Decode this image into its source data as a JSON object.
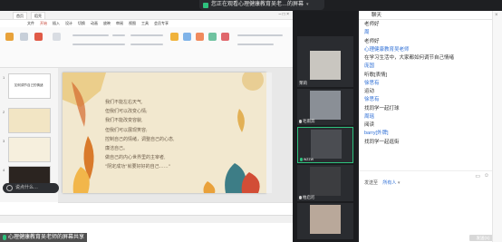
{
  "banner": {
    "text": "您正在观看心理健康教育吴老…的屏幕"
  },
  "wps": {
    "tabs": [
      "首页",
      "稻壳"
    ],
    "ribbon_tabs": [
      "文件",
      "开始",
      "插入",
      "设计",
      "切换",
      "动画",
      "放映",
      "审阅",
      "视图",
      "工具",
      "会员专享"
    ]
  },
  "thumb_title": "如何调节自己的情绪",
  "slide": {
    "lines": [
      "我们不能左右天气,",
      "但我们可以改变心情;",
      "我们不能改变容貌,",
      "但我们可以展现笑容;",
      "控制自己的情绪，调整自己的心态,",
      "廉洁自己。",
      "做自己的内心世界里的主宰者,",
      "\"阴定成功\"就要好好的自己……\""
    ]
  },
  "input_hint": "说点什么…",
  "share_label": "心理健康教育吴老师的屏幕共享",
  "gallery": [
    {
      "name": "心理健康教育吴老师",
      "host": true
    },
    {
      "name": "茉莉",
      "host": false
    },
    {
      "name": "毛雨奔",
      "host": false
    },
    {
      "name": "wzzw",
      "host": false
    },
    {
      "name": "柏启尼",
      "host": false
    },
    {
      "name": "",
      "host": false
    }
  ],
  "chat": {
    "title": "聊天",
    "messages": [
      {
        "kind": "msg",
        "text": "老师好"
      },
      {
        "kind": "sender",
        "text": "周"
      },
      {
        "kind": "msg",
        "text": "老师好"
      },
      {
        "kind": "sender",
        "text": "心理健康教育吴老师"
      },
      {
        "kind": "msg",
        "text": "在学习生活中，大家都如何调节自己情绪"
      },
      {
        "kind": "sender",
        "text": "庞国"
      },
      {
        "kind": "msg",
        "text": "听歌[表情]"
      },
      {
        "kind": "sender",
        "text": "徐思有"
      },
      {
        "kind": "msg",
        "text": "运动"
      },
      {
        "kind": "sender",
        "text": "徐思有"
      },
      {
        "kind": "msg",
        "text": "找同学一起打球"
      },
      {
        "kind": "sender",
        "text": "周瑶"
      },
      {
        "kind": "msg",
        "text": "阅读"
      },
      {
        "kind": "sender",
        "text": "barry[外牌]"
      },
      {
        "kind": "msg",
        "text": "找同学一起逛街"
      }
    ],
    "to_label": "发送至",
    "to_value": "所有人",
    "send_label": "发送(S)"
  }
}
